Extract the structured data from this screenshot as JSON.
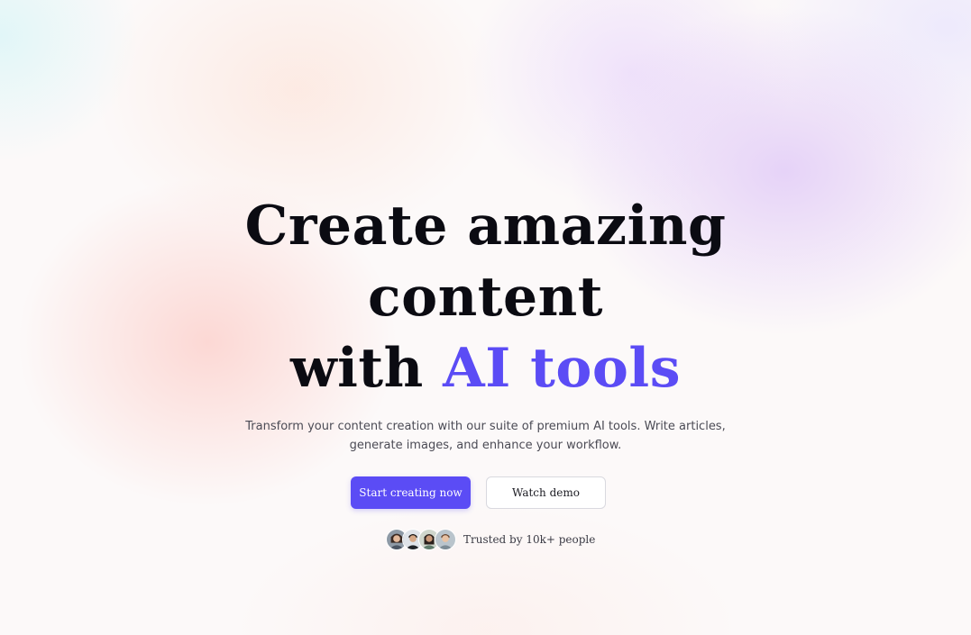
{
  "hero": {
    "headline_line1": "Create amazing",
    "headline_line2": "content",
    "headline_line3_prefix": "with ",
    "headline_line3_accent": "AI tools",
    "subtitle_line1": "Transform your content creation with our suite of premium AI tools. Write articles,",
    "subtitle_line2": "generate images, and enhance your workflow.",
    "primary_button_label": "Start creating now",
    "secondary_button_label": "Watch demo",
    "trusted_text": "Trusted by 10k+ people"
  },
  "colors": {
    "accent": "#5b4cf5",
    "text": "#0b0b12",
    "muted": "#4b4b55"
  },
  "avatars": [
    "avatar-person-1",
    "avatar-person-2",
    "avatar-person-3",
    "avatar-person-4"
  ]
}
